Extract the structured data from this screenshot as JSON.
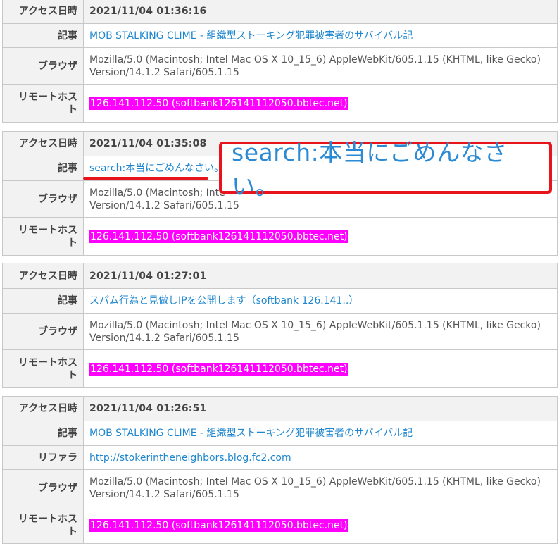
{
  "labels": {
    "access_time": "アクセス日時",
    "article": "記事",
    "browser": "ブラウザ",
    "referrer": "リファラ",
    "remote_host_1": "リモートホス",
    "remote_host_2": "ト"
  },
  "entries": [
    {
      "access_time": "2021/11/04 01:36:16",
      "article": "MOB STALKING CLIME - 組織型ストーキング犯罪被害者のサバイバル記",
      "browser_1": "Mozilla/5.0 (Macintosh; Intel Mac OS X 10_15_6) AppleWebKit/605.1.15 (KHTML, like Gecko)",
      "browser_2": "Version/14.1.2 Safari/605.1.15",
      "remote_host": "126.141.112.50 (softbank126141112050.bbtec.net)"
    },
    {
      "access_time": "2021/11/04 01:35:08",
      "article": "search:本当にごめんなさい。",
      "browser_1": "Mozilla/5.0 (Macintosh; Inte",
      "browser_2": "Version/14.1.2 Safari/605.1.15",
      "remote_host": "126.141.112.50 (softbank126141112050.bbtec.net)"
    },
    {
      "access_time": "2021/11/04 01:27:01",
      "article": "スパム行為と見做しIPを公開します（softbank 126.141..）",
      "browser_1": "Mozilla/5.0 (Macintosh; Intel Mac OS X 10_15_6) AppleWebKit/605.1.15 (KHTML, like Gecko)",
      "browser_2": "Version/14.1.2 Safari/605.1.15",
      "remote_host": "126.141.112.50 (softbank126141112050.bbtec.net)"
    },
    {
      "access_time": "2021/11/04 01:26:51",
      "article": "MOB STALKING CLIME - 組織型ストーキング犯罪被害者のサバイバル記",
      "referrer": "http://stokerintheneighbors.blog.fc2.com",
      "browser_1": "Mozilla/5.0 (Macintosh; Intel Mac OS X 10_15_6) AppleWebKit/605.1.15 (KHTML, like Gecko)",
      "browser_2": "Version/14.1.2 Safari/605.1.15",
      "remote_host": "126.141.112.50 (softbank126141112050.bbtec.net)"
    }
  ],
  "annotation": {
    "callout_text": "search:本当にごめんなさい。",
    "accent_color": "#e8141c"
  }
}
